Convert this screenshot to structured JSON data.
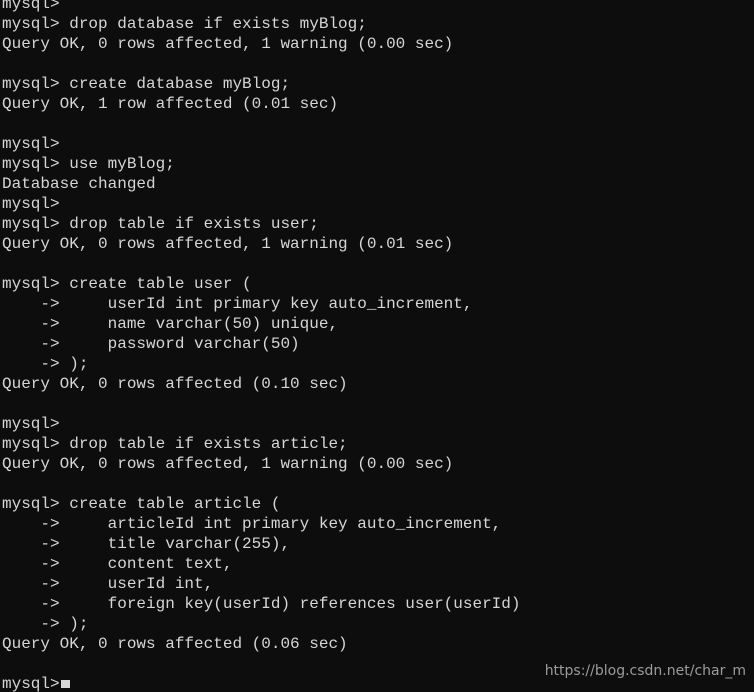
{
  "terminal": {
    "prompt": "mysql>",
    "continuation_prompt": "->",
    "background_color": "#0d0d0d",
    "text_color": "#d6d6d6",
    "cursor": "block-cursor",
    "lines": [
      "mysql>",
      "mysql> drop database if exists myBlog;",
      "Query OK, 0 rows affected, 1 warning (0.00 sec)",
      "",
      "mysql> create database myBlog;",
      "Query OK, 1 row affected (0.01 sec)",
      "",
      "mysql>",
      "mysql> use myBlog;",
      "Database changed",
      "mysql>",
      "mysql> drop table if exists user;",
      "Query OK, 0 rows affected, 1 warning (0.01 sec)",
      "",
      "mysql> create table user (",
      "    ->     userId int primary key auto_increment,",
      "    ->     name varchar(50) unique,",
      "    ->     password varchar(50)",
      "    -> );",
      "Query OK, 0 rows affected (0.10 sec)",
      "",
      "mysql>",
      "mysql> drop table if exists article;",
      "Query OK, 0 rows affected, 1 warning (0.00 sec)",
      "",
      "mysql> create table article (",
      "    ->     articleId int primary key auto_increment,",
      "    ->     title varchar(255),",
      "    ->     content text,",
      "    ->     userId int,",
      "    ->     foreign key(userId) references user(userId)",
      "    -> );",
      "Query OK, 0 rows affected (0.06 sec)",
      "",
      "mysql>"
    ]
  },
  "watermark": {
    "text": "https://blog.csdn.net/char_m",
    "color": "#9b9b9b"
  }
}
